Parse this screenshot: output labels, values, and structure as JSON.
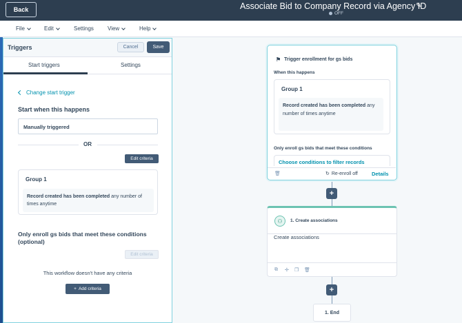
{
  "header": {
    "back_label": "Back",
    "title": "Associate Bid to Company Record via Agency ID",
    "status": "OFF"
  },
  "menu": {
    "items": [
      {
        "label": "File"
      },
      {
        "label": "Edit"
      },
      {
        "label": "Settings"
      },
      {
        "label": "View"
      },
      {
        "label": "Help"
      }
    ]
  },
  "panel": {
    "title": "Triggers",
    "cancel_label": "Cancel",
    "save_label": "Save",
    "tabs": [
      {
        "label": "Start triggers",
        "active": true
      },
      {
        "label": "Settings",
        "active": false
      }
    ],
    "change_trigger_label": "Change start trigger",
    "start_heading": "Start when this happens",
    "trigger_value": "Manually triggered",
    "or_label": "OR",
    "edit_criteria_label": "Edit criteria",
    "group": {
      "title": "Group 1",
      "condition_bold": "Record created has been completed",
      "condition_rest": " any number of times anytime"
    },
    "enroll_heading": "Only enroll gs bids that meet these conditions (optional)",
    "edit_criteria_disabled_label": "Edit criteria",
    "no_criteria_text": "This workflow doesn't have any criteria",
    "add_criteria_label": "Add criteria"
  },
  "canvas": {
    "trigger_card": {
      "header": "Trigger enrollment for gs bids",
      "when_label": "When this happens",
      "group_title": "Group 1",
      "condition_bold": "Record created has been completed",
      "condition_rest": " any number of times anytime",
      "only_enroll_label": "Only enroll gs bids that meet these conditions",
      "filter_link": "Choose conditions to filter records",
      "reenroll_label": "Re-enroll off",
      "details_label": "Details"
    },
    "action_card": {
      "title": "1. Create associations",
      "body": "Create associations"
    },
    "end_label": "1. End"
  },
  "colors": {
    "header_bg": "#2d3e50",
    "accent_teal": "#0091ae",
    "button_dark": "#425b76",
    "panel_border": "#7fd1de",
    "action_accent": "#6cc3b1"
  },
  "icons": [
    "pencil-icon",
    "flag-icon",
    "trash-icon",
    "refresh-icon",
    "people-icon",
    "copy-icon",
    "move-icon",
    "clone-icon",
    "plus-icon",
    "chevron-left-icon",
    "chevron-down-icon"
  ]
}
